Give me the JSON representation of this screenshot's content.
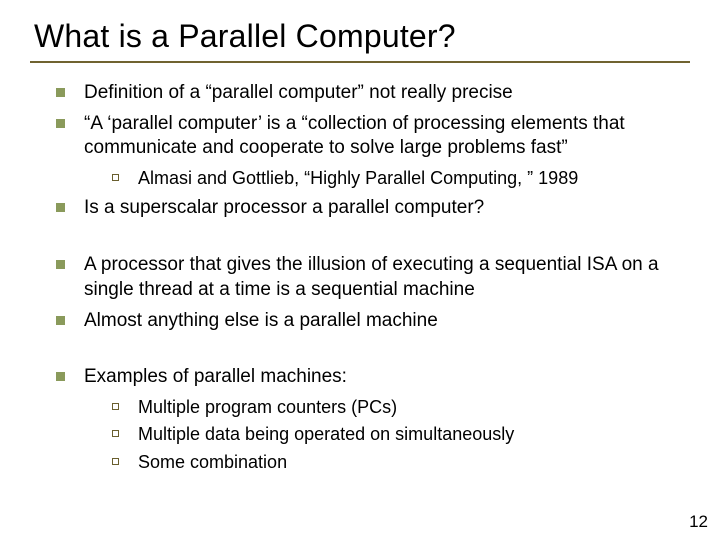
{
  "title": "What is a Parallel Computer?",
  "bullets": {
    "b1": "Definition of a “parallel computer” not really precise",
    "b2": "“A ‘parallel computer’ is a “collection of processing elements that communicate and cooperate to solve large problems fast”",
    "b2_sub1": "Almasi and Gottlieb, “Highly Parallel Computing, ” 1989",
    "b3": "Is a superscalar processor a parallel computer?",
    "b4": "A processor that gives the illusion of executing a sequential ISA on a single thread at a time is a sequential machine",
    "b5": "Almost anything else is a parallel machine",
    "b6": "Examples of parallel machines:",
    "b6_sub1": "Multiple program counters (PCs)",
    "b6_sub2": "Multiple data being operated on simultaneously",
    "b6_sub3": "Some combination"
  },
  "page_number": "12"
}
